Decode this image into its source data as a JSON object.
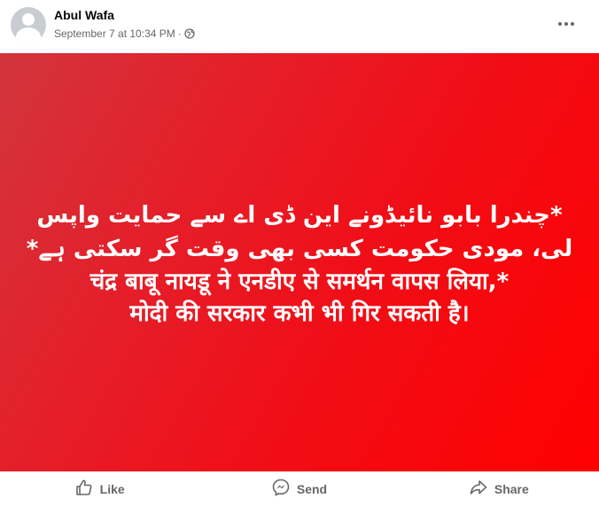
{
  "post": {
    "author": "Abul Wafa",
    "timestamp": "September 7 at 10:34 PM",
    "separator": "·",
    "privacy_icon": "globe-icon",
    "more_icon": "more-horizontal-icon"
  },
  "media": {
    "background_color": "#ff0000",
    "text_color": "#ffffff",
    "urdu_line_1": "*چندرا بابو نائیڈونے این ڈی اے سے حمایت واپس",
    "urdu_line_2": "لی، مودی حکومت کسی بھی وقت گر سکتی ہے*",
    "hindi_line_1": "चंद्र बाबू नायडू ने एनडीए से समर्थन वापस लिया,*",
    "hindi_line_2": "मोदी की सरकार कभी भी गिर सकती है।"
  },
  "actions": {
    "like_label": "Like",
    "send_label": "Send",
    "share_label": "Share",
    "text_color": "#65676b"
  }
}
